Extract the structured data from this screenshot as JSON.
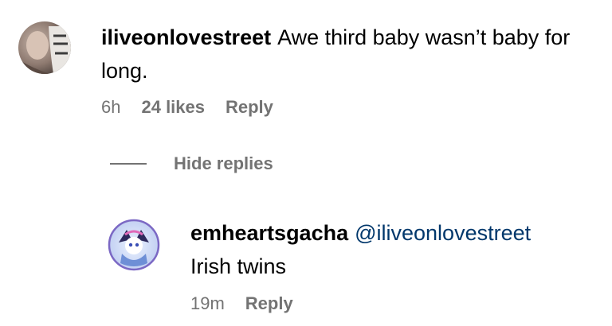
{
  "comment": {
    "username": "iliveonlovestreet",
    "text": "Awe third baby wasn’t baby for long.",
    "time": "6h",
    "likes": "24 likes",
    "reply_label": "Reply"
  },
  "replies_toggle": {
    "label": "Hide replies"
  },
  "reply": {
    "username": "emheartsgacha",
    "mention": "@iliveonlovestreet",
    "text": "Irish twins",
    "time": "19m",
    "reply_label": "Reply"
  },
  "colors": {
    "meta_text": "#737373",
    "mention": "#00376b",
    "reply_avatar_ring": "#7b68c4"
  }
}
